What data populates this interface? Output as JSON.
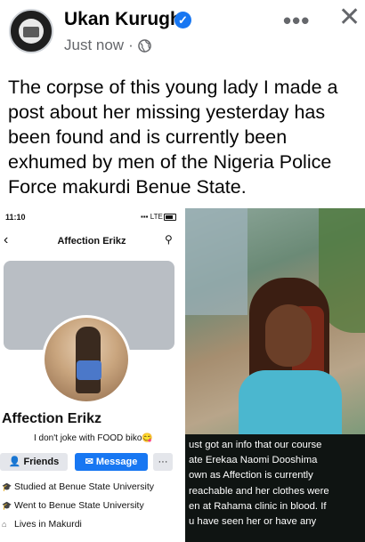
{
  "post": {
    "author": "Ukan Kurugh",
    "timestamp": "Just now",
    "separator": "·",
    "caption": "The corpse of this young lady I made a post about her missing yesterday has been found and is currently been exhumed by men of the  Nigeria Police Force makurdi Benue State.",
    "more_label": "•••",
    "close_label": "✕"
  },
  "profile_screenshot": {
    "status_time": "11:10",
    "status_signal": "▪▪▪ LTE",
    "title": "Affection Erikz",
    "name": "Affection Erikz",
    "bio": "I don't joke with FOOD biko😋",
    "buttons": {
      "friends": "👤 Friends",
      "message": "✉ Message",
      "more": "···"
    },
    "info": [
      {
        "icon": "graduation-icon",
        "text": "Studied at Benue State University"
      },
      {
        "icon": "graduation-icon",
        "text": "Went to Benue State University"
      },
      {
        "icon": "home-icon",
        "text": "Lives in Makurdi"
      }
    ]
  },
  "photo_screenshot": {
    "text_lines": [
      "ust got an info that our course",
      "ate Erekaa Naomi Dooshima",
      "own as Affection is currently",
      "reachable and her clothes were",
      "en at Rahama clinic in blood. If",
      "u have seen her or have any"
    ]
  },
  "colors": {
    "accent": "#1877f2",
    "secondary_text": "#65676b"
  }
}
